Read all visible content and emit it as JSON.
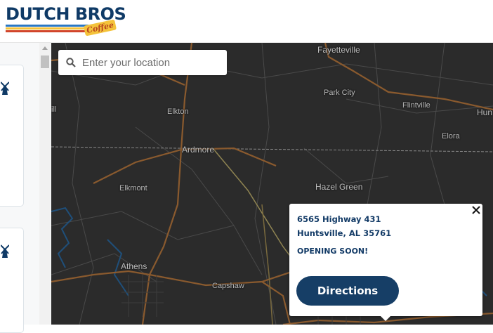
{
  "brand": {
    "name": "DUTCH BROS",
    "script": "Coffee",
    "colors": {
      "navy": "#0f3a66",
      "blue": "#2a77c3",
      "yellow": "#f4c33b",
      "red": "#d2452a"
    }
  },
  "search": {
    "placeholder": "Enter your location",
    "value": ""
  },
  "map": {
    "places": [
      "Fayetteville",
      "Park City",
      "Flintville",
      "Hun",
      "Elkton",
      "Elora",
      "ill",
      "Ardmore",
      "Elkmont",
      "Hazel Green",
      "Athens",
      "Capshaw"
    ]
  },
  "popup": {
    "address_line1": "6565 Highway 431",
    "address_line2": "Huntsville, AL 35761",
    "status": "OPENING SOON!",
    "directions_label": "Directions"
  }
}
